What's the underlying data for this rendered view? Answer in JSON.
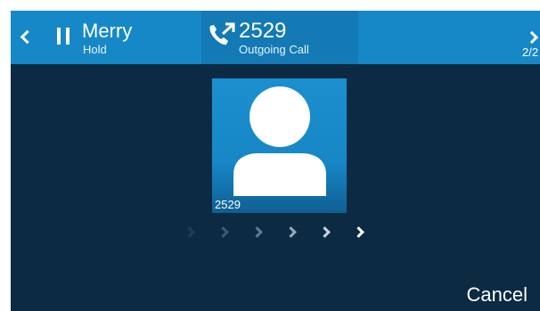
{
  "header": {
    "held_call": {
      "name": "Merry",
      "status": "Hold"
    },
    "active_call": {
      "number": "2529",
      "status": "Outgoing Call"
    },
    "page_indicator": "2/2"
  },
  "contact": {
    "label": "2529"
  },
  "progress": {
    "arrow_count": 6
  },
  "softkeys": {
    "cancel": "Cancel"
  },
  "colors": {
    "screen_bg": "#0c2b43",
    "header_bg": "#1688c8",
    "header_active_bg": "#137ab6",
    "avatar_bg": "#1787c6",
    "text": "#ffffff"
  },
  "icons": [
    "chevron-left-icon",
    "pause-icon",
    "outgoing-call-icon",
    "chevron-right-icon",
    "person-icon"
  ]
}
